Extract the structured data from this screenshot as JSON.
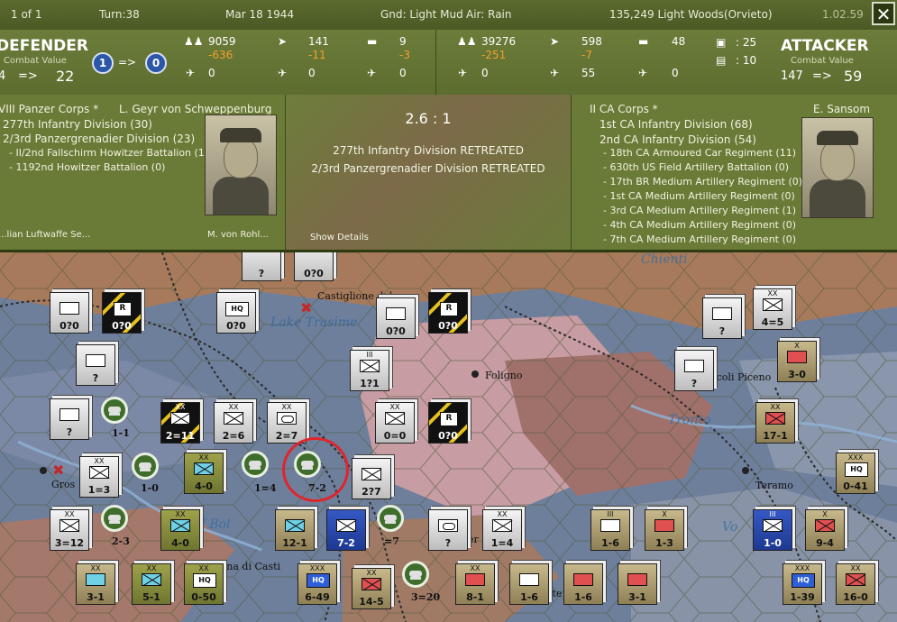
{
  "status": {
    "page": "1 of 1",
    "turn": "Turn:38",
    "date": "Mar 18 1944",
    "ground": "Gnd: Light Mud",
    "air": "Air: Rain",
    "location": "135,249  Light Woods(Orvieto)",
    "version": "1.02.59",
    "close_label": "✕"
  },
  "defender": {
    "title": "DEFENDER",
    "cv_label": "Combat Value",
    "cv_from": "4",
    "arrow": "=>",
    "cv_to": "22",
    "token_from": "1",
    "token_arrow": "=>",
    "token_to": "0",
    "men": "9059",
    "men_loss": "-636",
    "guns": "141",
    "guns_loss": "-11",
    "tanks": "9",
    "tanks_loss": "-3",
    "planes_a": "0",
    "planes_b": "0",
    "planes_c": "0",
    "corps": "VIII Panzer Corps *",
    "commander": "L. Geyr von Schweppenburg",
    "units": [
      "277th Infantry Division (30)",
      "2/3rd Panzergrenadier Division (23)",
      "- II/2nd Fallschirm Howitzer Battalion (1)",
      "- 1192nd Howitzer Battalion (0)"
    ],
    "cut_line": "...lian Luftwaffe Se...",
    "cut_line2": "M. von Rohl..."
  },
  "result": {
    "ratio": "2.6 : 1",
    "lines": [
      "277th Infantry Division RETREATED",
      "2/3rd Panzergrenadier Division RETREATED"
    ],
    "show_details": "Show Details"
  },
  "attacker": {
    "title": "ATTACKER",
    "cv_label": "Combat Value",
    "cv_from": "147",
    "arrow": "=>",
    "cv_to": "59",
    "men": "39276",
    "men_loss": "-251",
    "guns": "598",
    "guns_loss": "-7",
    "tanks": "48",
    "planes_a": "0",
    "planes_b": "55",
    "planes_c": "0",
    "supply_a": ": 25",
    "supply_b": ": 10",
    "corps": "II CA Corps *",
    "commander": "E. Sansom",
    "units": [
      "1st CA Infantry Division (68)",
      "2nd CA Infantry Division (54)",
      "- 18th CA Armoured Car Regiment (11)",
      "- 630th US Field Artillery Battalion (0)",
      "- 17th BR Medium Artillery Regiment (0)",
      "- 1st CA Medium Artillery Regiment (0)",
      "- 3rd CA Medium Artillery Regiment (1)",
      "- 4th CA Medium Artillery Regiment (0)",
      "- 7th CA Medium Artillery Regiment (0)"
    ]
  },
  "map": {
    "labels": {
      "chienti": "Chienti",
      "castiglione": "Castiglione del",
      "trasimeno": "Lake Trasime",
      "foligno": "Foligno",
      "ascoli": "scoli Piceno",
      "tronto": "Tronto",
      "teramo": "Teramo",
      "grosseto": "Gros",
      "bolsena": "ke of Bol",
      "orvieto": "rlena di Casti",
      "vo": "Vo",
      "er": "er",
      "ete": "ete"
    },
    "units": [
      {
        "id": "u1",
        "values": "?",
        "size": ""
      },
      {
        "id": "u2",
        "values": "0?0",
        "size": ""
      },
      {
        "id": "u3",
        "values": "0?0",
        "size": ""
      },
      {
        "id": "u4",
        "values": "0?0",
        "size": ""
      },
      {
        "id": "u5",
        "values": "0?0",
        "size": "",
        "flag": "R"
      },
      {
        "id": "u6",
        "values": "0?0",
        "size": "",
        "hq": "HQ"
      },
      {
        "id": "u7",
        "values": "0?0",
        "size": ""
      },
      {
        "id": "u8",
        "values": "0?0",
        "size": "",
        "flag": "R"
      },
      {
        "id": "u9",
        "values": "?",
        "size": ""
      },
      {
        "id": "u10",
        "values": "4=5",
        "size": "XX"
      },
      {
        "id": "u11",
        "values": "?",
        "size": ""
      },
      {
        "id": "u12",
        "values": "1?1",
        "size": "III"
      },
      {
        "id": "u13",
        "values": "?",
        "size": ""
      },
      {
        "id": "u14",
        "values": "3-0",
        "size": "X"
      },
      {
        "id": "u15",
        "values": "?",
        "size": ""
      },
      {
        "id": "u16",
        "values": "1-1",
        "size": ""
      },
      {
        "id": "u17",
        "values": "2=11",
        "size": "XX"
      },
      {
        "id": "u18",
        "values": "2=6",
        "size": "XX"
      },
      {
        "id": "u19",
        "values": "2=7",
        "size": "XX"
      },
      {
        "id": "u20",
        "values": "0=0",
        "size": "XX"
      },
      {
        "id": "u21",
        "values": "0?0",
        "size": "",
        "flag": "R"
      },
      {
        "id": "u22",
        "values": "17-1",
        "size": "XX"
      },
      {
        "id": "u23",
        "values": "1=3",
        "size": "XX"
      },
      {
        "id": "u24",
        "values": "1-0",
        "size": ""
      },
      {
        "id": "u25",
        "values": "4-0",
        "size": "XX"
      },
      {
        "id": "u26",
        "values": "1=4",
        "size": ""
      },
      {
        "id": "u27",
        "values": "7-2",
        "size": ""
      },
      {
        "id": "u28",
        "values": "2?7",
        "size": ""
      },
      {
        "id": "u29",
        "values": "0-41",
        "size": "XXX",
        "hq": "HQ"
      },
      {
        "id": "u30",
        "values": "3=12",
        "size": "XX"
      },
      {
        "id": "u31",
        "values": "2-3",
        "size": ""
      },
      {
        "id": "u32",
        "values": "4-0",
        "size": "XX"
      },
      {
        "id": "u33",
        "values": "12-1",
        "size": ""
      },
      {
        "id": "u34",
        "values": "7-2",
        "size": ""
      },
      {
        "id": "u35",
        "values": "=7",
        "size": ""
      },
      {
        "id": "u36",
        "values": "?",
        "size": ""
      },
      {
        "id": "u37",
        "values": "1=4",
        "size": "XX"
      },
      {
        "id": "u38",
        "values": "1-6",
        "size": "III"
      },
      {
        "id": "u39",
        "values": "1-3",
        "size": "X"
      },
      {
        "id": "u40",
        "values": "1-0",
        "size": "III"
      },
      {
        "id": "u41",
        "values": "9-4",
        "size": "X"
      },
      {
        "id": "u42",
        "values": "3-1",
        "size": "XX"
      },
      {
        "id": "u43",
        "values": "5-1",
        "size": "XX"
      },
      {
        "id": "u44",
        "values": "0-50",
        "size": "XX",
        "hq": "HQ"
      },
      {
        "id": "u45",
        "values": "6-49",
        "size": "XXX",
        "hq": "HQ"
      },
      {
        "id": "u46",
        "values": "14-5",
        "size": "XX"
      },
      {
        "id": "u47",
        "values": "3=20",
        "size": ""
      },
      {
        "id": "u48",
        "values": "8-1",
        "size": "XX"
      },
      {
        "id": "u49",
        "values": "1-6",
        "size": ""
      },
      {
        "id": "u50",
        "values": "1-6",
        "size": ""
      },
      {
        "id": "u51",
        "values": "3-1",
        "size": ""
      },
      {
        "id": "u52",
        "values": "1-39",
        "size": "XXX",
        "hq": "HQ"
      },
      {
        "id": "u53",
        "values": "16-0",
        "size": "XX"
      }
    ]
  },
  "colors": {
    "panel": "#6a7a37",
    "loss": "#f3a02a",
    "highlight": "#e0242a"
  }
}
